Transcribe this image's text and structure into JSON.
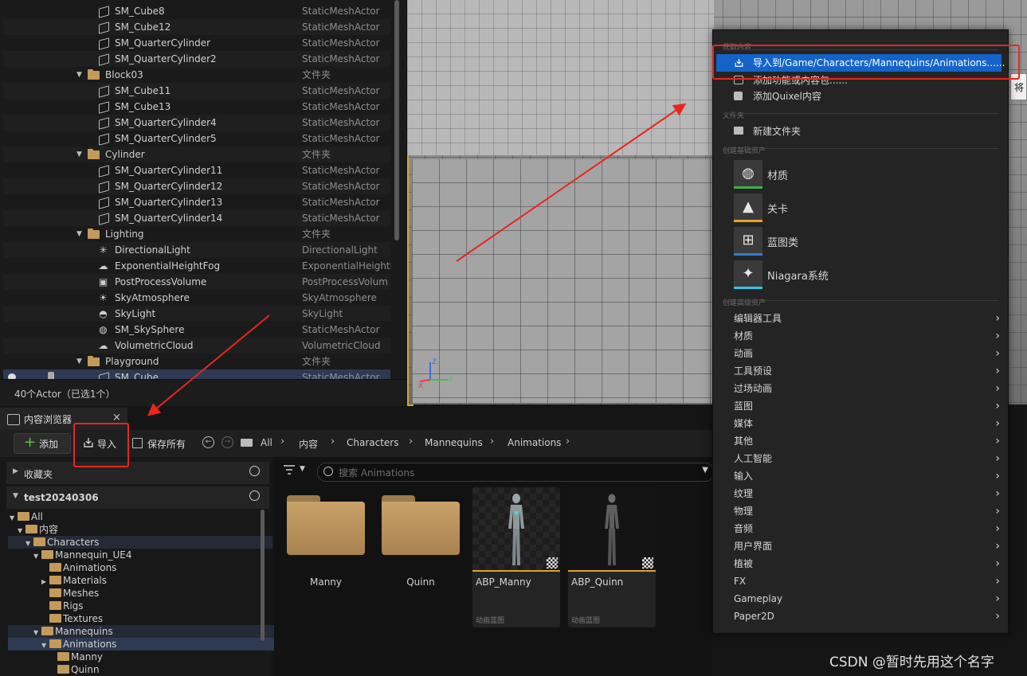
{
  "outliner": {
    "rows": [
      {
        "name": "SM_Cube8",
        "type": "StaticMeshActor",
        "indent": 2,
        "icon": "mesh-icon"
      },
      {
        "name": "SM_Cube12",
        "type": "StaticMeshActor",
        "indent": 2,
        "icon": "mesh-icon"
      },
      {
        "name": "SM_QuarterCylinder",
        "type": "StaticMeshActor",
        "indent": 2,
        "icon": "mesh-icon"
      },
      {
        "name": "SM_QuarterCylinder2",
        "type": "StaticMeshActor",
        "indent": 2,
        "icon": "mesh-icon"
      },
      {
        "name": "Block03",
        "type": "文件夹",
        "indent": 1,
        "icon": "folder-icon",
        "caret": "▼"
      },
      {
        "name": "SM_Cube11",
        "type": "StaticMeshActor",
        "indent": 2,
        "icon": "mesh-icon"
      },
      {
        "name": "SM_Cube13",
        "type": "StaticMeshActor",
        "indent": 2,
        "icon": "mesh-icon"
      },
      {
        "name": "SM_QuarterCylinder4",
        "type": "StaticMeshActor",
        "indent": 2,
        "icon": "mesh-icon"
      },
      {
        "name": "SM_QuarterCylinder5",
        "type": "StaticMeshActor",
        "indent": 2,
        "icon": "mesh-icon"
      },
      {
        "name": "Cylinder",
        "type": "文件夹",
        "indent": 1,
        "icon": "folder-icon",
        "caret": "▼"
      },
      {
        "name": "SM_QuarterCylinder11",
        "type": "StaticMeshActor",
        "indent": 2,
        "icon": "mesh-icon"
      },
      {
        "name": "SM_QuarterCylinder12",
        "type": "StaticMeshActor",
        "indent": 2,
        "icon": "mesh-icon"
      },
      {
        "name": "SM_QuarterCylinder13",
        "type": "StaticMeshActor",
        "indent": 2,
        "icon": "mesh-icon"
      },
      {
        "name": "SM_QuarterCylinder14",
        "type": "StaticMeshActor",
        "indent": 2,
        "icon": "mesh-icon"
      },
      {
        "name": "Lighting",
        "type": "文件夹",
        "indent": 1,
        "icon": "folder-icon",
        "caret": "▼"
      },
      {
        "name": "DirectionalLight",
        "type": "DirectionalLight",
        "indent": 2,
        "icon": "sun-icon"
      },
      {
        "name": "ExponentialHeightFog",
        "type": "ExponentialHeightF",
        "indent": 2,
        "icon": "fog-icon"
      },
      {
        "name": "PostProcessVolume",
        "type": "PostProcessVolum",
        "indent": 2,
        "icon": "volume-icon"
      },
      {
        "name": "SkyAtmosphere",
        "type": "SkyAtmosphere",
        "indent": 2,
        "icon": "atmosphere-icon"
      },
      {
        "name": "SkyLight",
        "type": "SkyLight",
        "indent": 2,
        "icon": "skylight-icon"
      },
      {
        "name": "SM_SkySphere",
        "type": "StaticMeshActor",
        "indent": 2,
        "icon": "sphere-icon"
      },
      {
        "name": "VolumetricCloud",
        "type": "VolumetricCloud",
        "indent": 2,
        "icon": "cloud-icon"
      },
      {
        "name": "Playground",
        "type": "文件夹",
        "indent": 1,
        "icon": "folder-icon",
        "caret": "▼"
      },
      {
        "name": "SM_Cube",
        "type": "StaticMeshActor",
        "indent": 2,
        "icon": "mesh-icon",
        "selected": true
      }
    ],
    "footer": "40个Actor（已选1个）"
  },
  "content_browser": {
    "tab_title": "内容浏览器",
    "tab_close": "×",
    "add_label": "添加",
    "import_label": "导入",
    "save_all_label": "保存所有",
    "breadcrumb": [
      "All",
      "内容",
      "Characters",
      "Mannequins",
      "Animations"
    ],
    "favorites_label": "收藏夹",
    "project_label": "test20240306",
    "tree": [
      {
        "label": "All",
        "depth": 0,
        "caret": "▼"
      },
      {
        "label": "内容",
        "depth": 1,
        "caret": "▼"
      },
      {
        "label": "Characters",
        "depth": 2,
        "caret": "▼",
        "hl": true
      },
      {
        "label": "Mannequin_UE4",
        "depth": 3,
        "caret": "▼"
      },
      {
        "label": "Animations",
        "depth": 4,
        "caret": ""
      },
      {
        "label": "Materials",
        "depth": 4,
        "caret": "▶"
      },
      {
        "label": "Meshes",
        "depth": 4,
        "caret": ""
      },
      {
        "label": "Rigs",
        "depth": 4,
        "caret": ""
      },
      {
        "label": "Textures",
        "depth": 4,
        "caret": ""
      },
      {
        "label": "Mannequins",
        "depth": 3,
        "caret": "▼",
        "hl": true
      },
      {
        "label": "Animations",
        "depth": 4,
        "caret": "▼",
        "selected": true
      },
      {
        "label": "Manny",
        "depth": 5,
        "caret": ""
      },
      {
        "label": "Quinn",
        "depth": 5,
        "caret": ""
      }
    ],
    "search_placeholder": "搜索 Animations",
    "folders": [
      {
        "label": "Manny"
      },
      {
        "label": "Quinn"
      }
    ],
    "assets": [
      {
        "label": "ABP_Manny",
        "type": "动画蓝图"
      },
      {
        "label": "ABP_Quinn",
        "type": "动画蓝图"
      }
    ]
  },
  "context_menu": {
    "sections": {
      "get_content": "获取内容",
      "folder": "文件夹",
      "basic_assets": "创建基础资产",
      "advanced_assets": "创建高级资产"
    },
    "get_content_items": [
      {
        "label": "导入到/Game/Characters/Mannequins/Animations......",
        "highlighted": true
      },
      {
        "label": "添加功能或内容包......"
      },
      {
        "label": "添加Quixel内容"
      }
    ],
    "new_folder": "新建文件夹",
    "basic_assets": [
      {
        "label": "材质",
        "color": "#3fae4a",
        "icon": "material-icon"
      },
      {
        "label": "关卡",
        "color": "#e2a22a",
        "icon": "level-icon"
      },
      {
        "label": "蓝图类",
        "color": "#3a7bd5",
        "icon": "blueprint-icon"
      },
      {
        "label": "Niagara系统",
        "color": "#2ec6e6",
        "icon": "niagara-icon"
      }
    ],
    "advanced_assets": [
      "编辑器工具",
      "材质",
      "动画",
      "工具预设",
      "过场动画",
      "蓝图",
      "媒体",
      "其他",
      "人工智能",
      "输入",
      "纹理",
      "物理",
      "音频",
      "用户界面",
      "植被",
      "FX",
      "Gameplay",
      "Paper2D"
    ]
  },
  "tooltip_text": "将",
  "watermark": "CSDN @暂时先用这个名字",
  "colors": {
    "accent": "#1463c8",
    "selection": "#e2a22a",
    "annotation": "#e8261e"
  }
}
